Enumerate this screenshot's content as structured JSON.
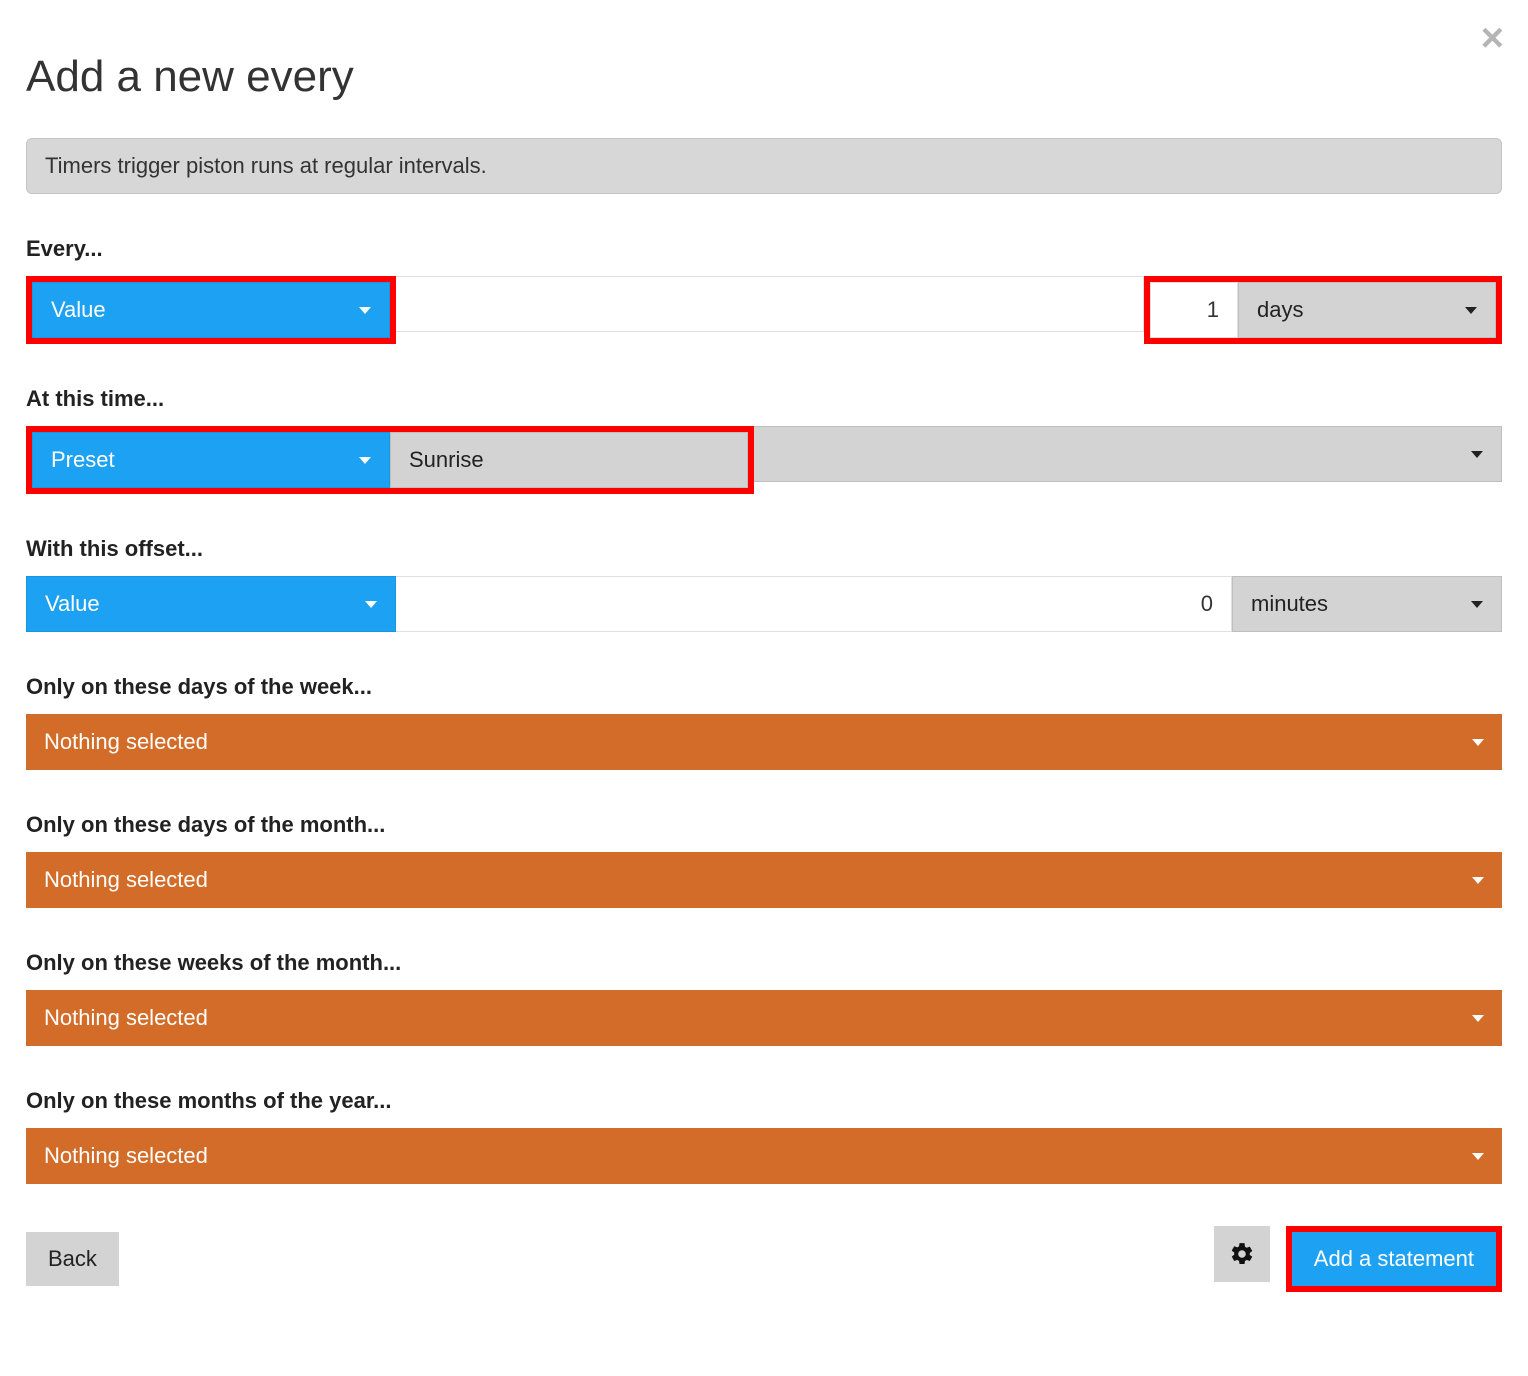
{
  "close_label": "×",
  "title": "Add a new every",
  "info": "Timers trigger piston runs at regular intervals.",
  "colors": {
    "accent": "#1da1f2",
    "orange": "#d36c28",
    "highlight": "#ff0000"
  },
  "every": {
    "label": "Every...",
    "type_dropdown": "Value",
    "amount": "1",
    "unit": "days"
  },
  "at_time": {
    "label": "At this time...",
    "type_dropdown": "Preset",
    "preset": "Sunrise"
  },
  "offset": {
    "label": "With this offset...",
    "type_dropdown": "Value",
    "amount": "0",
    "unit": "minutes"
  },
  "days_of_week": {
    "label": "Only on these days of the week...",
    "value": "Nothing selected"
  },
  "days_of_month": {
    "label": "Only on these days of the month...",
    "value": "Nothing selected"
  },
  "weeks_of_month": {
    "label": "Only on these weeks of the month...",
    "value": "Nothing selected"
  },
  "months_of_year": {
    "label": "Only on these months of the year...",
    "value": "Nothing selected"
  },
  "footer": {
    "back": "Back",
    "add": "Add a statement"
  }
}
